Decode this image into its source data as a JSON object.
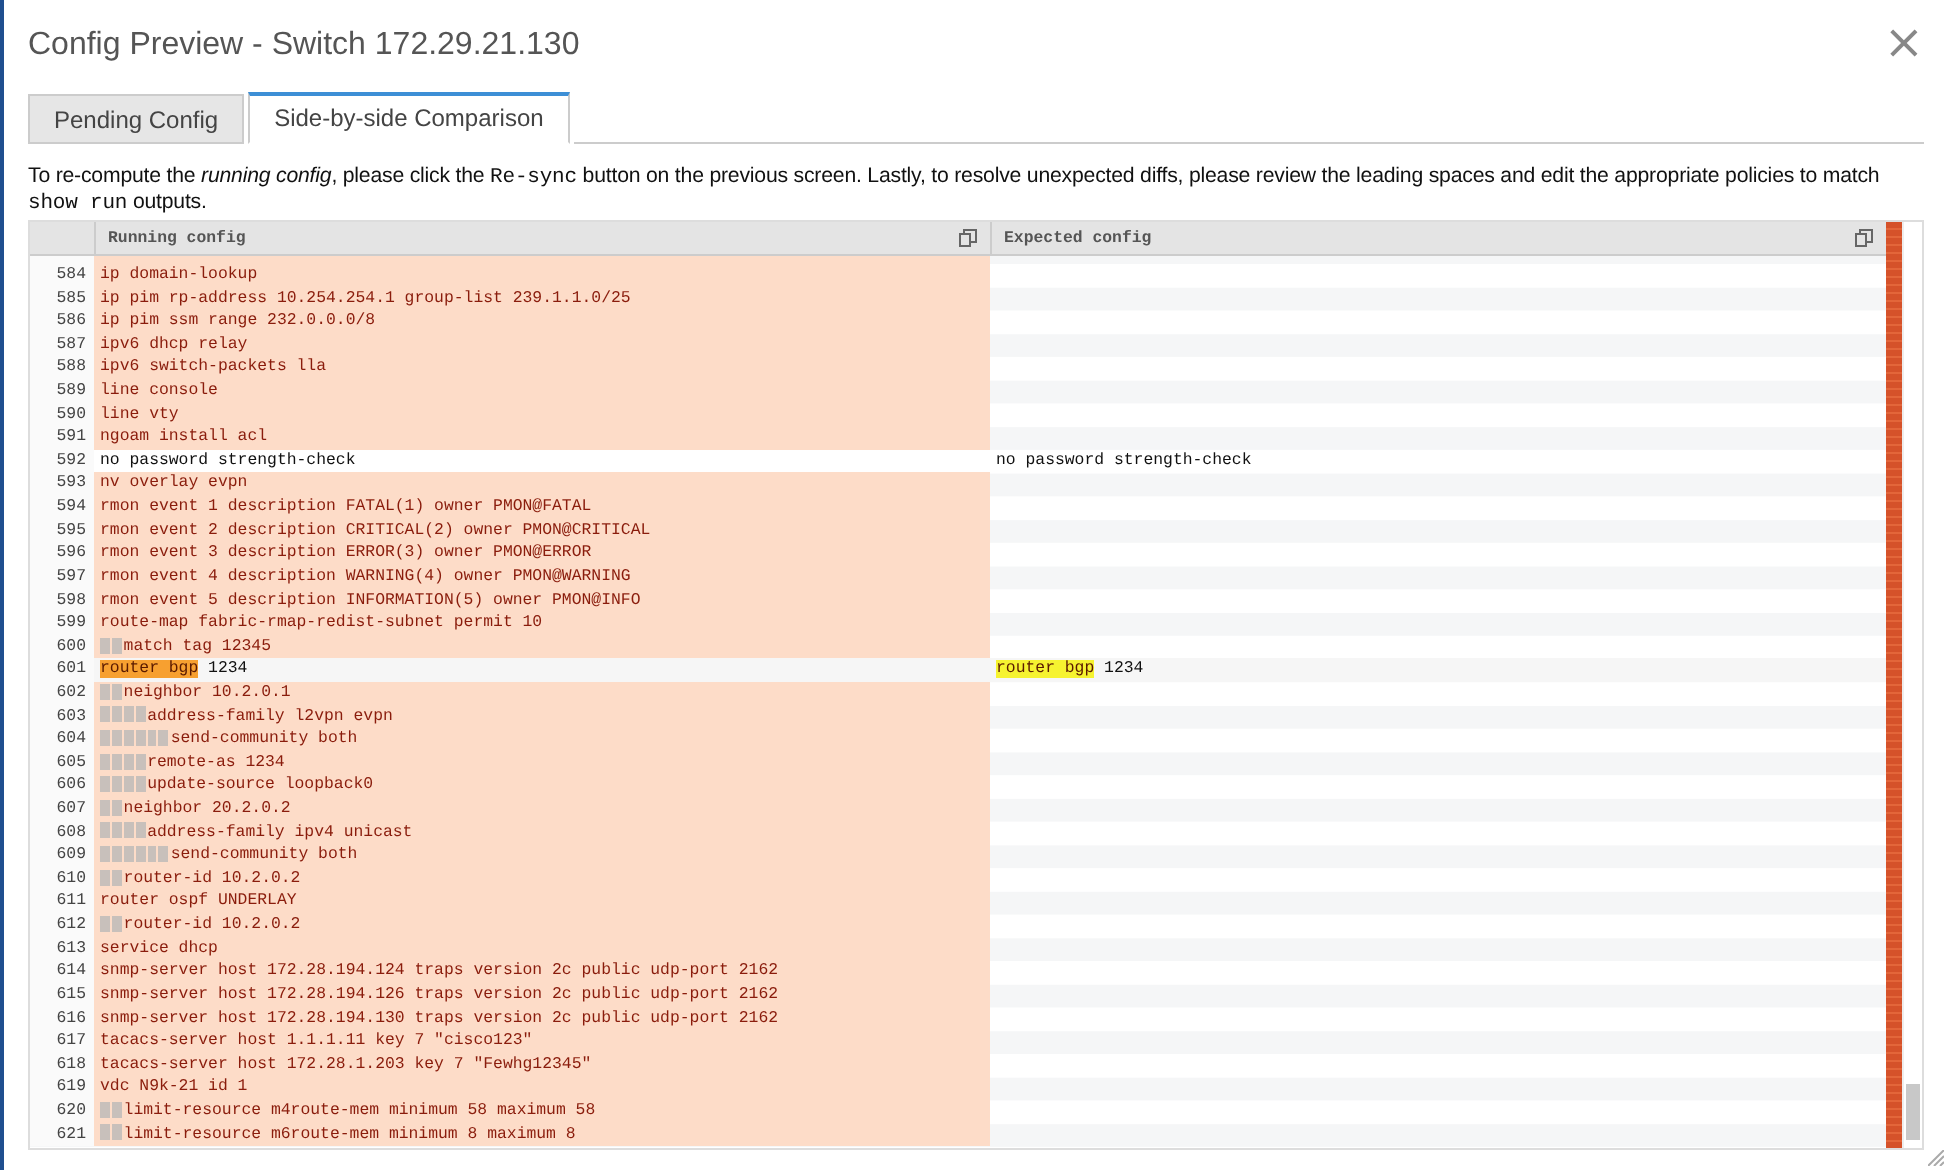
{
  "dialog": {
    "title": "Config Preview - Switch 172.29.21.130",
    "close": "×"
  },
  "tabs": [
    {
      "label": "Pending Config",
      "selected": false
    },
    {
      "label": "Side-by-side Comparison",
      "selected": true
    }
  ],
  "description": [
    {
      "kind": "plain",
      "text": "To re-compute the "
    },
    {
      "kind": "italic",
      "text": "running config"
    },
    {
      "kind": "plain",
      "text": ", please click the "
    },
    {
      "kind": "code",
      "text": "Re-sync"
    },
    {
      "kind": "plain",
      "text": " button on the previous screen. Lastly, to resolve unexpected diffs, please review the leading spaces and edit the appropriate policies to match "
    },
    {
      "kind": "code",
      "text": "show run"
    },
    {
      "kind": "plain",
      "text": " outputs."
    }
  ],
  "diff": {
    "left_title": "Running config",
    "right_title": "Expected config",
    "rows": [
      {
        "n": "584",
        "kind": "removed",
        "left": "ip domain-lookup",
        "right": ""
      },
      {
        "n": "585",
        "kind": "removed",
        "left": "ip pim rp-address 10.254.254.1 group-list 239.1.1.0/25",
        "right": ""
      },
      {
        "n": "586",
        "kind": "removed",
        "left": "ip pim ssm range 232.0.0.0/8",
        "right": ""
      },
      {
        "n": "587",
        "kind": "removed",
        "left": "ipv6 dhcp relay",
        "right": ""
      },
      {
        "n": "588",
        "kind": "removed",
        "left": "ipv6 switch-packets lla",
        "right": ""
      },
      {
        "n": "589",
        "kind": "removed",
        "left": "line console",
        "right": ""
      },
      {
        "n": "590",
        "kind": "removed",
        "left": "line vty",
        "right": ""
      },
      {
        "n": "591",
        "kind": "removed",
        "left": "ngoam install acl",
        "right": ""
      },
      {
        "n": "592",
        "kind": "same",
        "left": "no password strength-check",
        "right": "no password strength-check"
      },
      {
        "n": "593",
        "kind": "removed",
        "left": "nv overlay evpn",
        "right": ""
      },
      {
        "n": "594",
        "kind": "removed",
        "left": "rmon event 1 description FATAL(1) owner PMON@FATAL",
        "right": ""
      },
      {
        "n": "595",
        "kind": "removed",
        "left": "rmon event 2 description CRITICAL(2) owner PMON@CRITICAL",
        "right": ""
      },
      {
        "n": "596",
        "kind": "removed",
        "left": "rmon event 3 description ERROR(3) owner PMON@ERROR",
        "right": ""
      },
      {
        "n": "597",
        "kind": "removed",
        "left": "rmon event 4 description WARNING(4) owner PMON@WARNING",
        "right": ""
      },
      {
        "n": "598",
        "kind": "removed",
        "left": "rmon event 5 description INFORMATION(5) owner PMON@INFO",
        "right": ""
      },
      {
        "n": "599",
        "kind": "removed",
        "left": "route-map fabric-rmap-redist-subnet permit 10",
        "right": ""
      },
      {
        "n": "600",
        "kind": "removed",
        "left": "  match tag 12345",
        "right": ""
      },
      {
        "n": "601",
        "kind": "modified",
        "left": [
          {
            "text": "router bgp",
            "changed": true
          },
          {
            "text": " 1234",
            "changed": false
          }
        ],
        "right": [
          {
            "text": "router bgp",
            "changed": true
          },
          {
            "text": " 1234",
            "changed": false
          }
        ]
      },
      {
        "n": "602",
        "kind": "removed",
        "left": "  neighbor 10.2.0.1",
        "right": ""
      },
      {
        "n": "603",
        "kind": "removed",
        "left": "    address-family l2vpn evpn",
        "right": ""
      },
      {
        "n": "604",
        "kind": "removed",
        "left": "      send-community both",
        "right": ""
      },
      {
        "n": "605",
        "kind": "removed",
        "left": "    remote-as 1234",
        "right": ""
      },
      {
        "n": "606",
        "kind": "removed",
        "left": "    update-source loopback0",
        "right": ""
      },
      {
        "n": "607",
        "kind": "removed",
        "left": "  neighbor 20.2.0.2",
        "right": ""
      },
      {
        "n": "608",
        "kind": "removed",
        "left": "    address-family ipv4 unicast",
        "right": ""
      },
      {
        "n": "609",
        "kind": "removed",
        "left": "      send-community both",
        "right": ""
      },
      {
        "n": "610",
        "kind": "removed",
        "left": "  router-id 10.2.0.2",
        "right": ""
      },
      {
        "n": "611",
        "kind": "removed",
        "left": "router ospf UNDERLAY",
        "right": ""
      },
      {
        "n": "612",
        "kind": "removed",
        "left": "  router-id 10.2.0.2",
        "right": ""
      },
      {
        "n": "613",
        "kind": "removed",
        "left": "service dhcp",
        "right": ""
      },
      {
        "n": "614",
        "kind": "removed",
        "left": "snmp-server host 172.28.194.124 traps version 2c public udp-port 2162",
        "right": ""
      },
      {
        "n": "615",
        "kind": "removed",
        "left": "snmp-server host 172.28.194.126 traps version 2c public udp-port 2162",
        "right": ""
      },
      {
        "n": "616",
        "kind": "removed",
        "left": "snmp-server host 172.28.194.130 traps version 2c public udp-port 2162",
        "right": ""
      },
      {
        "n": "617",
        "kind": "removed",
        "left": "tacacs-server host 1.1.1.11 key 7 \"cisco123\"",
        "right": ""
      },
      {
        "n": "618",
        "kind": "removed",
        "left": "tacacs-server host 172.28.1.203 key 7 \"Fewhg12345\"",
        "right": ""
      },
      {
        "n": "619",
        "kind": "removed",
        "left": "vdc N9k-21 id 1",
        "right": ""
      },
      {
        "n": "620",
        "kind": "removed",
        "left": "  limit-resource m4route-mem minimum 58 maximum 58",
        "right": ""
      },
      {
        "n": "621",
        "kind": "removed",
        "left": "  limit-resource m6route-mem minimum 8 maximum 8",
        "right": ""
      }
    ]
  }
}
